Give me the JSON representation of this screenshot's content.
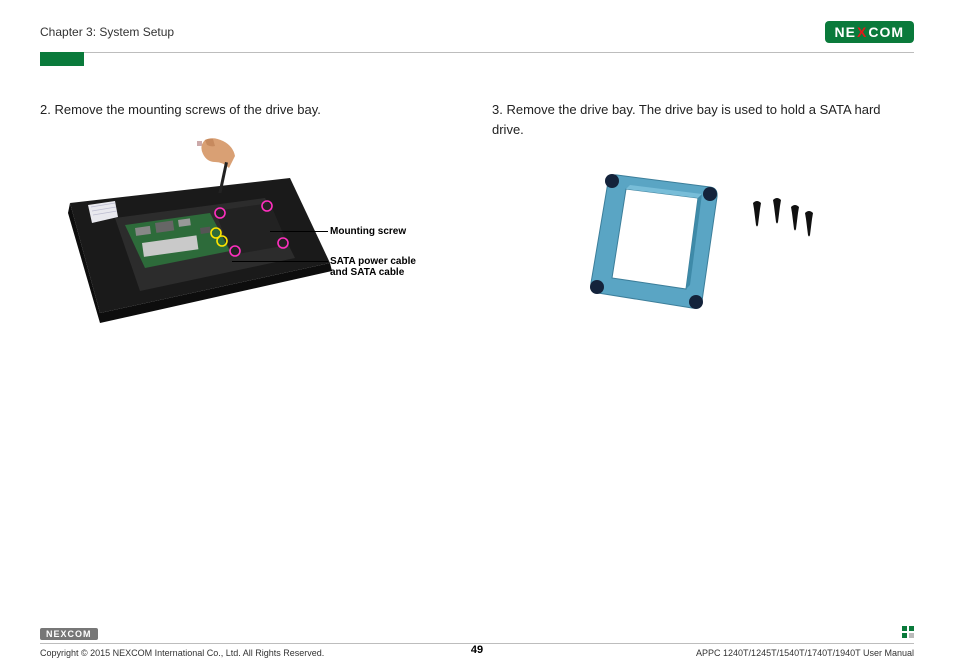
{
  "header": {
    "breadcrumb": "Chapter 3: System Setup",
    "logo_pre": "NE",
    "logo_x": "X",
    "logo_post": "COM"
  },
  "left": {
    "step_text": "2. Remove the mounting screws of the drive bay.",
    "callout_mounting": "Mounting screw",
    "callout_sata": "SATA power cable and SATA cable"
  },
  "right": {
    "step_text": "3. Remove the drive bay. The drive bay is used to hold a SATA hard drive."
  },
  "footer": {
    "logo_pre": "NE",
    "logo_x": "X",
    "logo_post": "COM",
    "copyright": "Copyright © 2015 NEXCOM International Co., Ltd. All Rights Reserved.",
    "page": "49",
    "doc": "APPC 1240T/1245T/1540T/1740T/1940T User Manual"
  }
}
